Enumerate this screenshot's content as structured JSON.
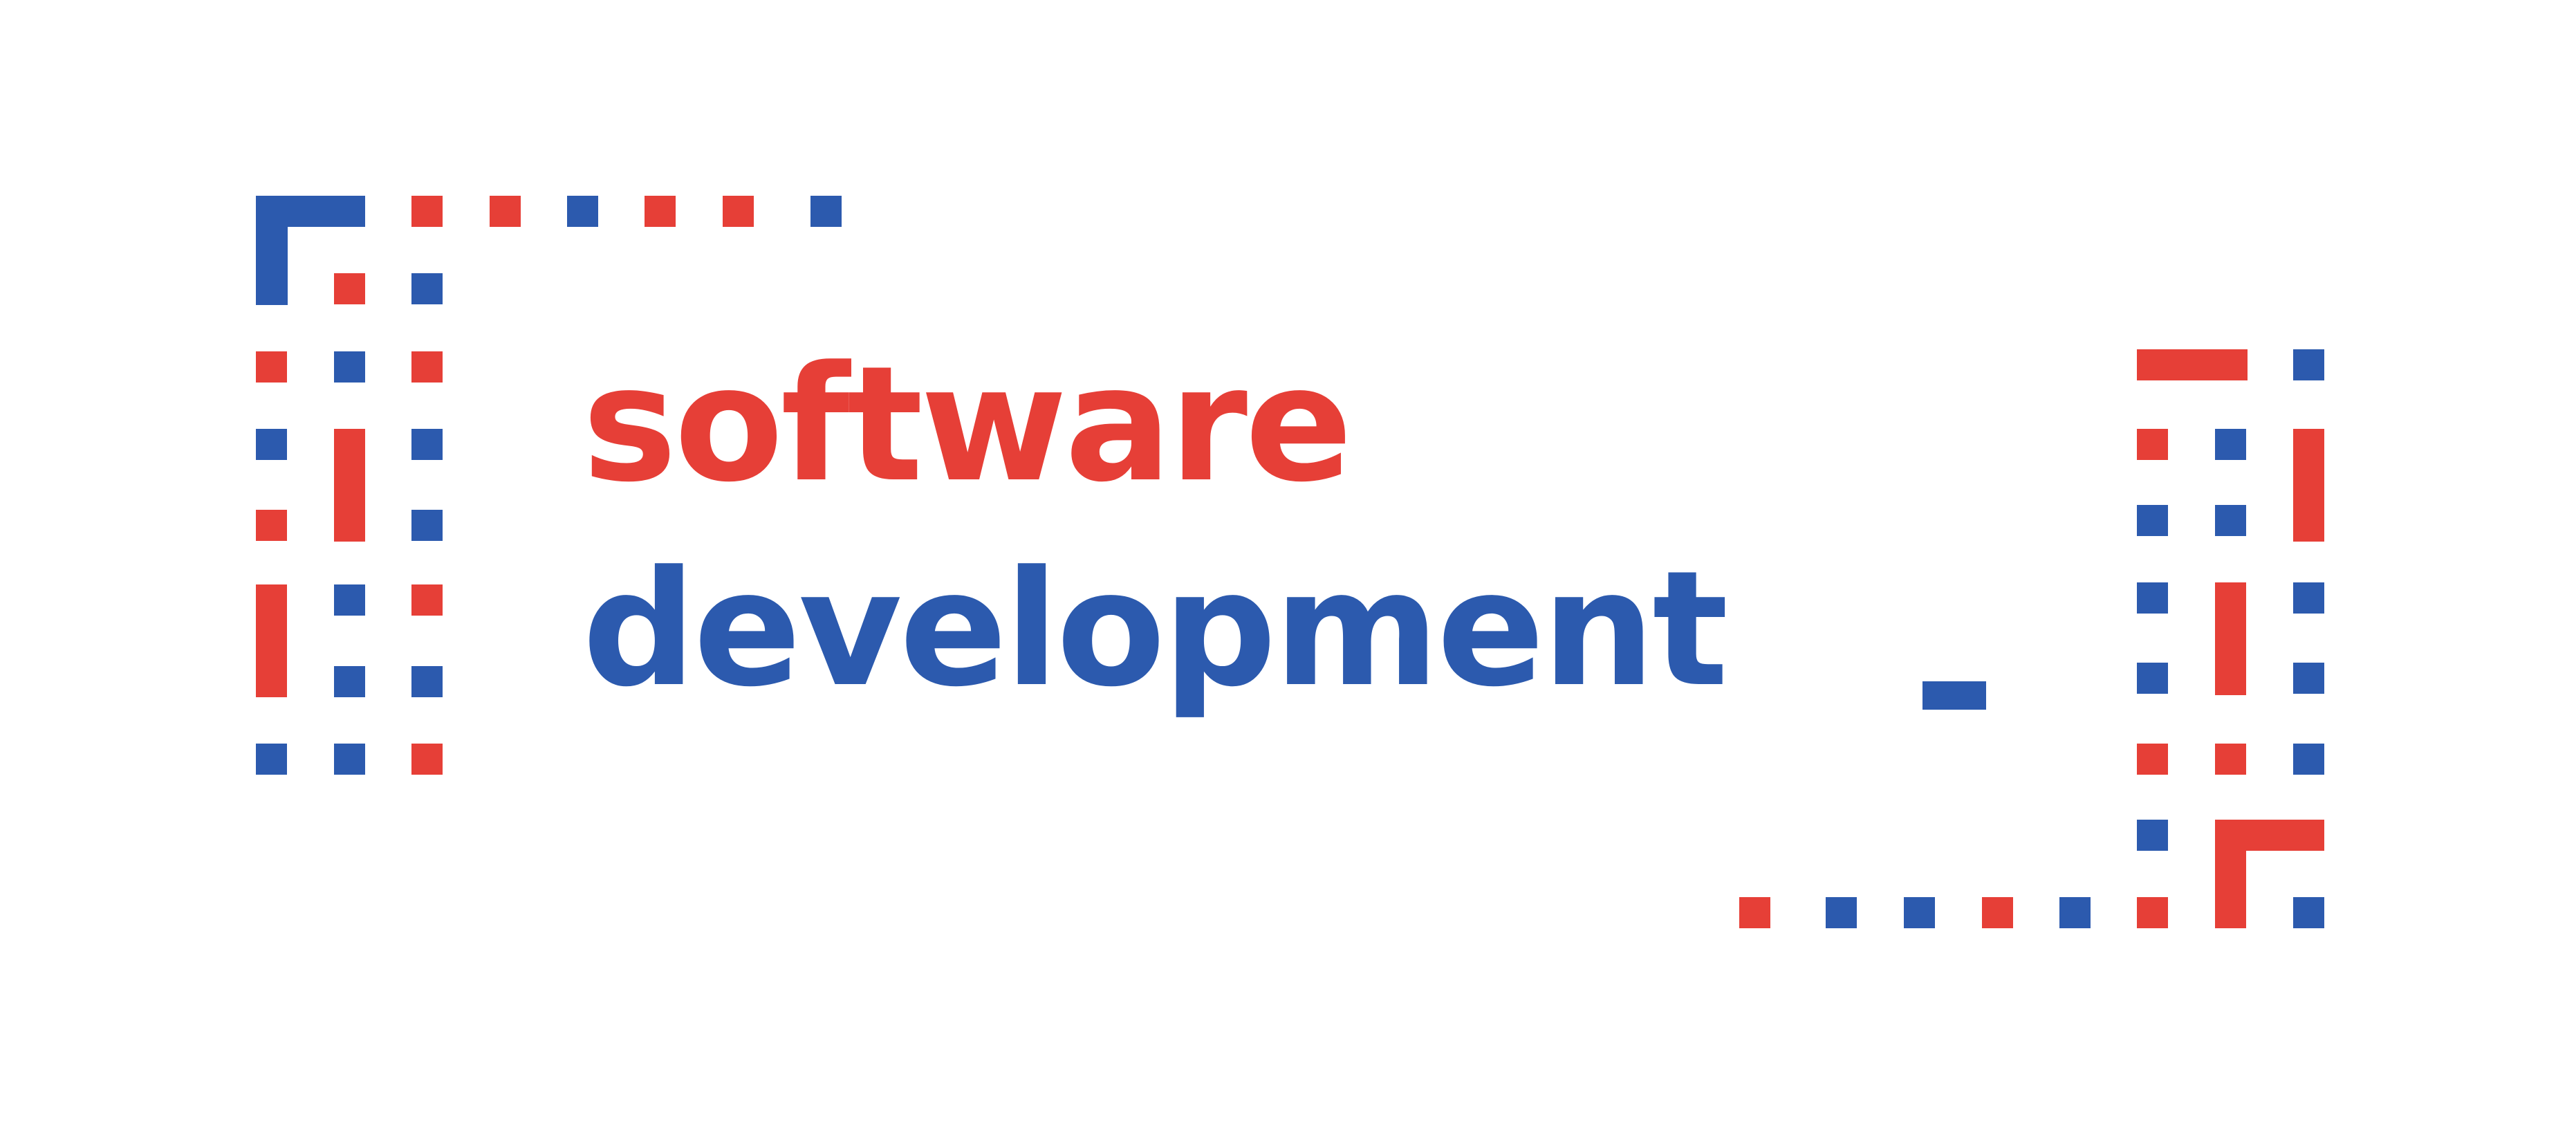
{
  "title": {
    "line1": "software",
    "line2": "development"
  },
  "colors": {
    "red": "#E63F37",
    "blue": "#2C5AAE",
    "background": "#FFFFFF"
  },
  "decoration": {
    "cursor": "underscore-cursor",
    "frames": "dotted-bracket-frames"
  }
}
